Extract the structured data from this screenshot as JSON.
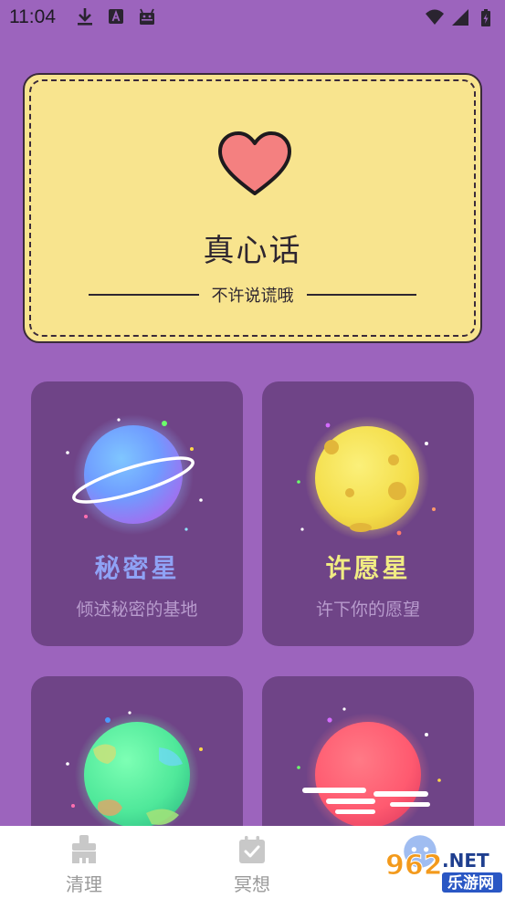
{
  "status_bar": {
    "time": "11:04",
    "left_icons": [
      "download-icon",
      "a-icon",
      "android-icon"
    ],
    "right_icons": [
      "wifi-icon",
      "signal-icon",
      "battery-charging-icon"
    ]
  },
  "truth_card": {
    "title": "真心话",
    "subtitle": "不许说谎哦",
    "icon": "heart-icon",
    "colors": {
      "card": "#f8e48e",
      "heart": "#f48080"
    }
  },
  "tiles": [
    {
      "title": "秘密星",
      "subtitle": "倾述秘密的基地",
      "title_color": "#8fa2f5",
      "planet": "blue-ringed-planet"
    },
    {
      "title": "许愿星",
      "subtitle": "许下你的愿望",
      "title_color": "#f1ec83",
      "planet": "yellow-moon-planet"
    },
    {
      "planet": "green-planet"
    },
    {
      "planet": "red-planet"
    }
  ],
  "tab_bar": {
    "items": [
      {
        "label": "清理",
        "icon": "broom-icon"
      },
      {
        "label": "冥想",
        "icon": "calendar-check-icon"
      },
      {
        "label": "",
        "icon": "mascot-icon"
      }
    ]
  },
  "watermark": {
    "text_main": "962.NET",
    "text_sub": "乐游网"
  },
  "colors": {
    "background": "#9c64bd",
    "tile": "#6f4487",
    "tab_bar": "#ffffff"
  }
}
